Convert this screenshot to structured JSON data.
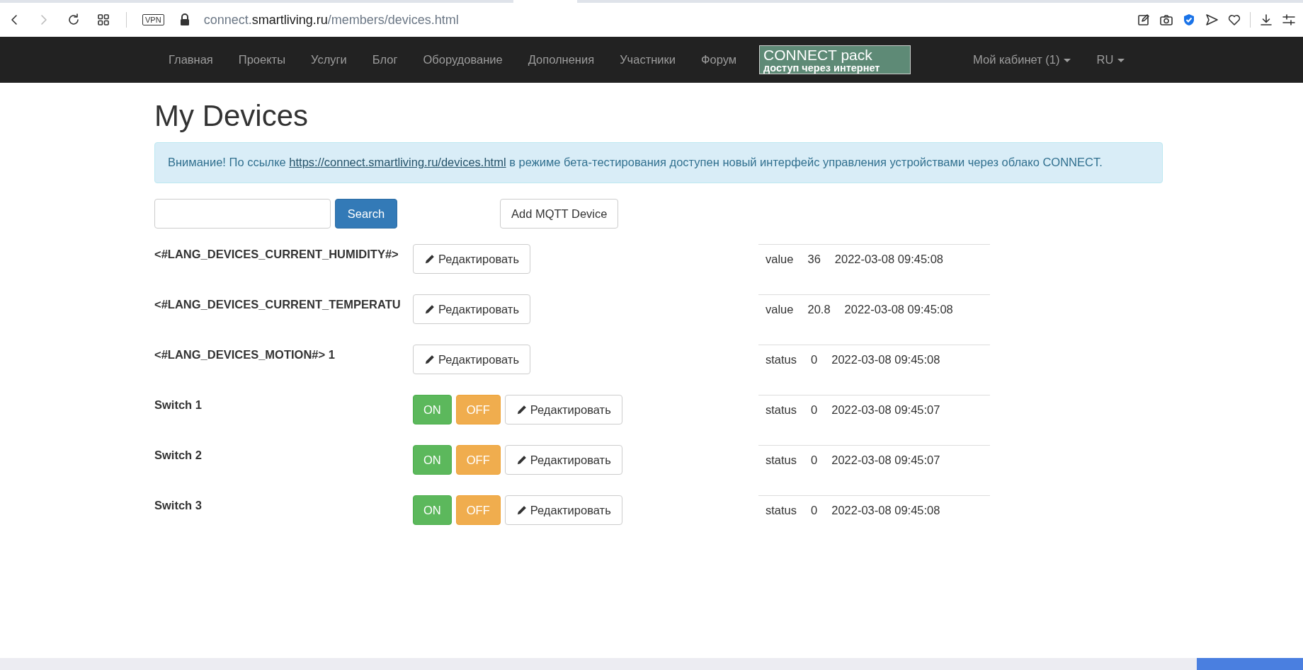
{
  "browser": {
    "url": {
      "subdomain": "connect.",
      "domain": "smartliving.ru",
      "path": "/members/devices.html"
    },
    "vpn_badge": "VPN"
  },
  "nav": {
    "items": [
      {
        "label": "Главная"
      },
      {
        "label": "Проекты"
      },
      {
        "label": "Услуги"
      },
      {
        "label": "Блог"
      },
      {
        "label": "Оборудование"
      },
      {
        "label": "Дополнения"
      },
      {
        "label": "Участники"
      },
      {
        "label": "Форум"
      }
    ],
    "banner": {
      "title": "CONNECT pack",
      "subtitle": "доступ через интернет"
    },
    "account": "Мой кабинет (1)",
    "language": "RU"
  },
  "page_title": "My Devices",
  "alert": {
    "before": "Внимание! По ссылке ",
    "link": "https://connect.smartliving.ru/devices.html",
    "after": " в режиме бета-тестирования доступен новый интерфейс управления устройствами через облако CONNECT."
  },
  "search": {
    "button": "Search"
  },
  "add_button": "Add MQTT Device",
  "devices": [
    {
      "kind": "sensor",
      "name": "<#LANG_DEVICES_CURRENT_HUMIDITY#>",
      "edit": "Редактировать",
      "property": "value",
      "value": "36",
      "updated": "2022-03-08 09:45:08"
    },
    {
      "kind": "sensor",
      "name": "<#LANG_DEVICES_CURRENT_TEMPERATU",
      "edit": "Редактировать",
      "property": "value",
      "value": "20.8",
      "updated": "2022-03-08 09:45:08"
    },
    {
      "kind": "sensor",
      "name": "<#LANG_DEVICES_MOTION#> 1",
      "edit": "Редактировать",
      "property": "status",
      "value": "0",
      "updated": "2022-03-08 09:45:08"
    },
    {
      "kind": "switch",
      "name": "Switch 1",
      "on": "ON",
      "off": "OFF",
      "edit": "Редактировать",
      "property": "status",
      "value": "0",
      "updated": "2022-03-08 09:45:07"
    },
    {
      "kind": "switch",
      "name": "Switch 2",
      "on": "ON",
      "off": "OFF",
      "edit": "Редактировать",
      "property": "status",
      "value": "0",
      "updated": "2022-03-08 09:45:07"
    },
    {
      "kind": "switch",
      "name": "Switch 3",
      "on": "ON",
      "off": "OFF",
      "edit": "Редактировать",
      "property": "status",
      "value": "0",
      "updated": "2022-03-08 09:45:08"
    }
  ]
}
